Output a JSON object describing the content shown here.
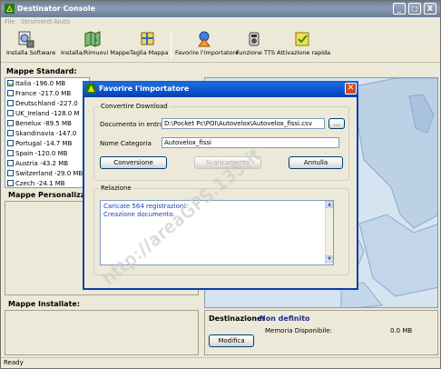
{
  "window": {
    "title": "Destinator Console",
    "controls": [
      "_",
      "□",
      "X"
    ]
  },
  "menu": {
    "items": [
      "File",
      "Strumenti",
      "Aiuto"
    ]
  },
  "toolbar": {
    "buttons": [
      {
        "label": "Installa Software",
        "icon": "install-software-icon"
      },
      {
        "label": "Installa/Rimuovi Mappe",
        "icon": "install-maps-icon"
      },
      {
        "label": "Taglia Mappa",
        "icon": "cut-map-icon"
      },
      {
        "label": "Favorire l'importatore",
        "icon": "importer-icon"
      },
      {
        "label": "Funzione TTS",
        "icon": "tts-icon"
      },
      {
        "label": "Attivazione rapida",
        "icon": "quick-activation-icon"
      }
    ]
  },
  "left": {
    "standard_maps_title": "Mappe Standard:",
    "maps": [
      {
        "label": "Italia -196.0 MB",
        "checked": true
      },
      {
        "label": "France -217.0 MB",
        "checked": false
      },
      {
        "label": "Deutschland -227.0",
        "checked": false
      },
      {
        "label": "UK_Ireland -128.0 M",
        "checked": false
      },
      {
        "label": "Benelux -89.5 MB",
        "checked": false
      },
      {
        "label": "Skandinavia -147.0",
        "checked": false
      },
      {
        "label": "Portugal -14.7 MB",
        "checked": false
      },
      {
        "label": "Spain -120.0 MB",
        "checked": false
      },
      {
        "label": "Austria -43.2 MB",
        "checked": false
      },
      {
        "label": "Switzerland -29.0 MB",
        "checked": false
      },
      {
        "label": "Czech -24.1 MB",
        "checked": false
      }
    ],
    "custom_maps_title": "Mappe Personalizzat",
    "installed_maps_title": "Mappe Installate:"
  },
  "destination": {
    "label": "Destinazione:",
    "value": "Non definito",
    "memory_label": "Memoria Disponibile:",
    "memory_value": "0.0 MB",
    "modify_button": "Modifica"
  },
  "status": {
    "text": "Ready"
  },
  "dialog": {
    "title": "Favorire l'importatore",
    "group_title": "Convertire Download",
    "input_label": "Documento in entrata",
    "input_value": "D:\\Pocket Pc\\POI\\Autovelox\\Autovelox_fissi.csv",
    "browse_button": "...",
    "category_label": "Nome Categoria",
    "category_value": "Autovelox_fissi",
    "convert_button": "Conversione",
    "download_button": "Scaricamento",
    "cancel_button": "Annulla",
    "report_title": "Relazione",
    "report_lines": [
      "Caricate 564 registrazioni.",
      "Creazione documento."
    ]
  },
  "watermark": {
    "text": "http://areaGPS.135.it"
  },
  "colors": {
    "window_bg": "#ece9d8",
    "dialog_title": "#0a5cf0",
    "close_button": "#d64a1e",
    "report_text": "#1f3cb0"
  }
}
